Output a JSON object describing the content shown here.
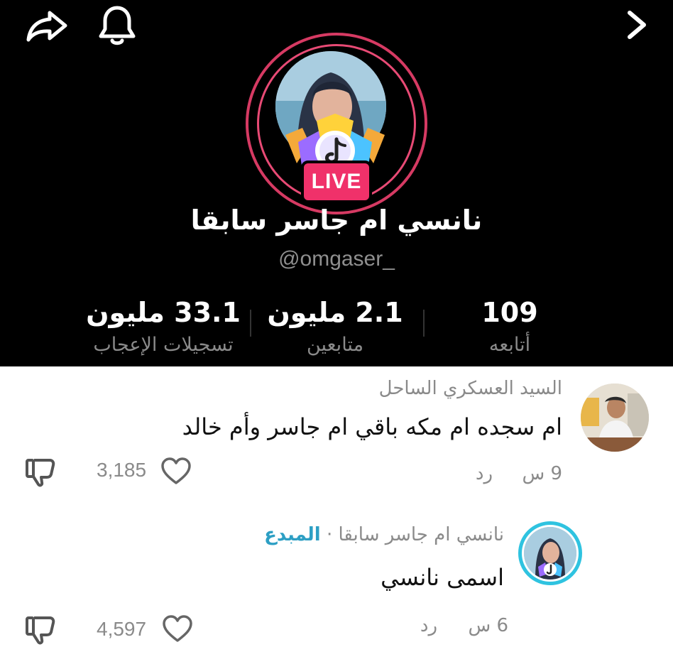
{
  "header": {
    "share_icon": "share-icon",
    "bell_icon": "bell-icon",
    "chevron_icon": "chevron-right-icon"
  },
  "profile": {
    "live_label": "LIVE",
    "display_name": "نانسي ام جاسر سابقا",
    "handle": "@omgaser_",
    "ring_color": "#d63a63",
    "live_color": "#f0316a"
  },
  "stats": {
    "following": {
      "value": "109",
      "label": "أتابعه"
    },
    "followers": {
      "value": "2.1 مليون",
      "label": "متابعين"
    },
    "likes": {
      "value": "33.1 مليون",
      "label": "تسجيلات الإعجاب"
    }
  },
  "comments": [
    {
      "author": "السيد العسكري الساحل",
      "text": "ام سجده ام مكه باقي ام جاسر وأم خالد",
      "time": "9 س",
      "reply": "رد",
      "likes": "3,185"
    },
    {
      "author": "نانسي ام جاسر سابقا",
      "separator": "·",
      "creator_tag": "المبدع",
      "creator_color": "#2d9fc4",
      "text": "اسمى نانسي",
      "time": "6 س",
      "reply": "رد",
      "likes": "4,597"
    }
  ]
}
